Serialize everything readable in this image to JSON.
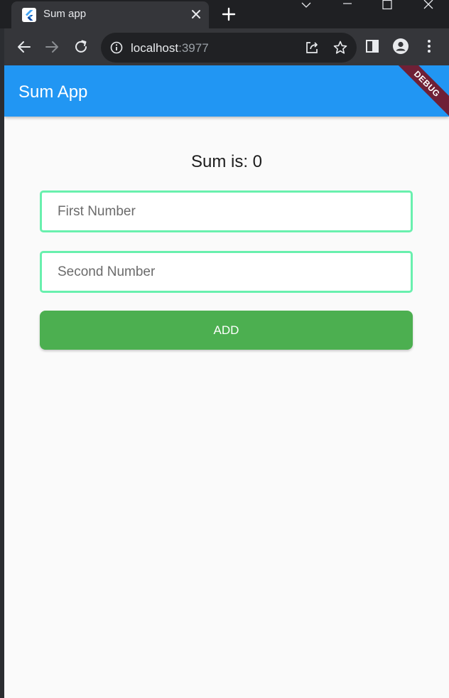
{
  "browser": {
    "tab": {
      "title": "Sum app"
    },
    "url": {
      "host": "localhost",
      "port": ":3977"
    }
  },
  "app": {
    "title": "Sum App",
    "debug_label": "DEBUG",
    "sum_text": "Sum is: 0",
    "first_field": {
      "placeholder": "First Number",
      "value": ""
    },
    "second_field": {
      "placeholder": "Second Number",
      "value": ""
    },
    "add_button": "ADD"
  },
  "colors": {
    "appbar": "#2196f3",
    "field_border": "#69f0ae",
    "button": "#4caf50",
    "debug_banner": "#6f2036"
  },
  "icons": [
    "flutter-icon",
    "close-icon",
    "plus-icon",
    "chevron-down-icon",
    "minimize-icon",
    "maximize-icon",
    "back-arrow-icon",
    "forward-arrow-icon",
    "reload-icon",
    "info-icon",
    "share-icon",
    "star-icon",
    "side-panel-icon",
    "profile-icon",
    "kebab-menu-icon"
  ]
}
